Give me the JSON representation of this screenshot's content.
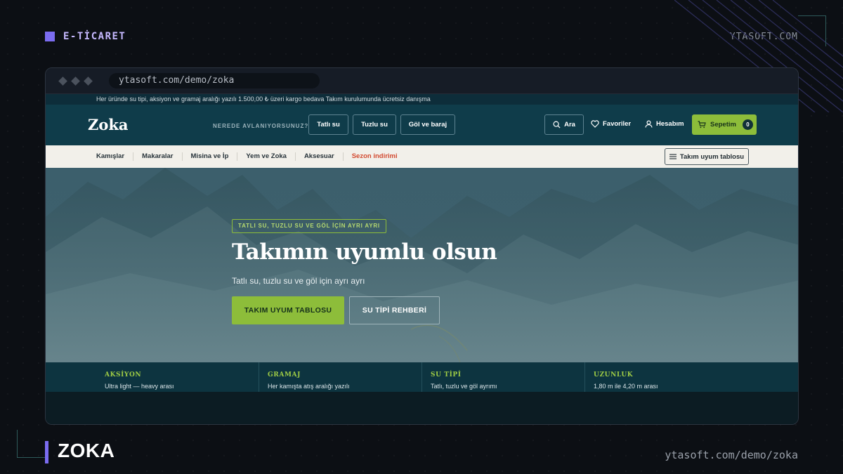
{
  "slide": {
    "category": "E-TİCARET",
    "brand": "YTASOFT.COM",
    "title": "ZOKA",
    "url": "ytasoft.com/demo/zoka"
  },
  "browser": {
    "address": "ytasoft.com/demo/zoka"
  },
  "site": {
    "announcement": "Her üründe su tipi, aksiyon ve gramaj aralığı yazılı 1.500,00 ₺ üzeri kargo bedava Takım kurulumunda ücretsiz danışma",
    "logo": "Zoka",
    "where_label": "NEREDE AVLANIYORSUNUZ?",
    "water_buttons": [
      "Tatlı su",
      "Tuzlu su",
      "Göl ve baraj"
    ],
    "search_label": "Ara",
    "favorites_label": "Favoriler",
    "account_label": "Hesabım",
    "cart_label": "Sepetim",
    "cart_count": "0",
    "categories": [
      "Kamışlar",
      "Makaralar",
      "Misina ve İp",
      "Yem ve Zoka",
      "Aksesuar",
      "Sezon indirimi"
    ],
    "table_button": "Takım uyum tablosu",
    "hero": {
      "eyebrow": "TATLI SU, TUZLU SU VE GÖL İÇİN AYRI AYRI",
      "headline": "Takımın uyumlu olsun",
      "subline": "Tatlı su, tuzlu su ve göl için ayrı ayrı",
      "primary_cta": "TAKIM UYUM TABLOSU",
      "secondary_cta": "SU TİPİ REHBERİ"
    },
    "features": [
      {
        "title": "AKSİYON",
        "text": "Ultra light — heavy arası"
      },
      {
        "title": "GRAMAJ",
        "text": "Her kamışta atış aralığı yazılı"
      },
      {
        "title": "SU TİPİ",
        "text": "Tatlı, tuzlu ve göl ayrımı"
      },
      {
        "title": "UZUNLUK",
        "text": "1,80 m ile 4,20 m arası"
      }
    ],
    "colors": {
      "accent_green": "#8dbd3a",
      "nav_teal": "#0f3c4a",
      "sale_red": "#d24a30",
      "slide_purple": "#7b6cf0"
    }
  }
}
